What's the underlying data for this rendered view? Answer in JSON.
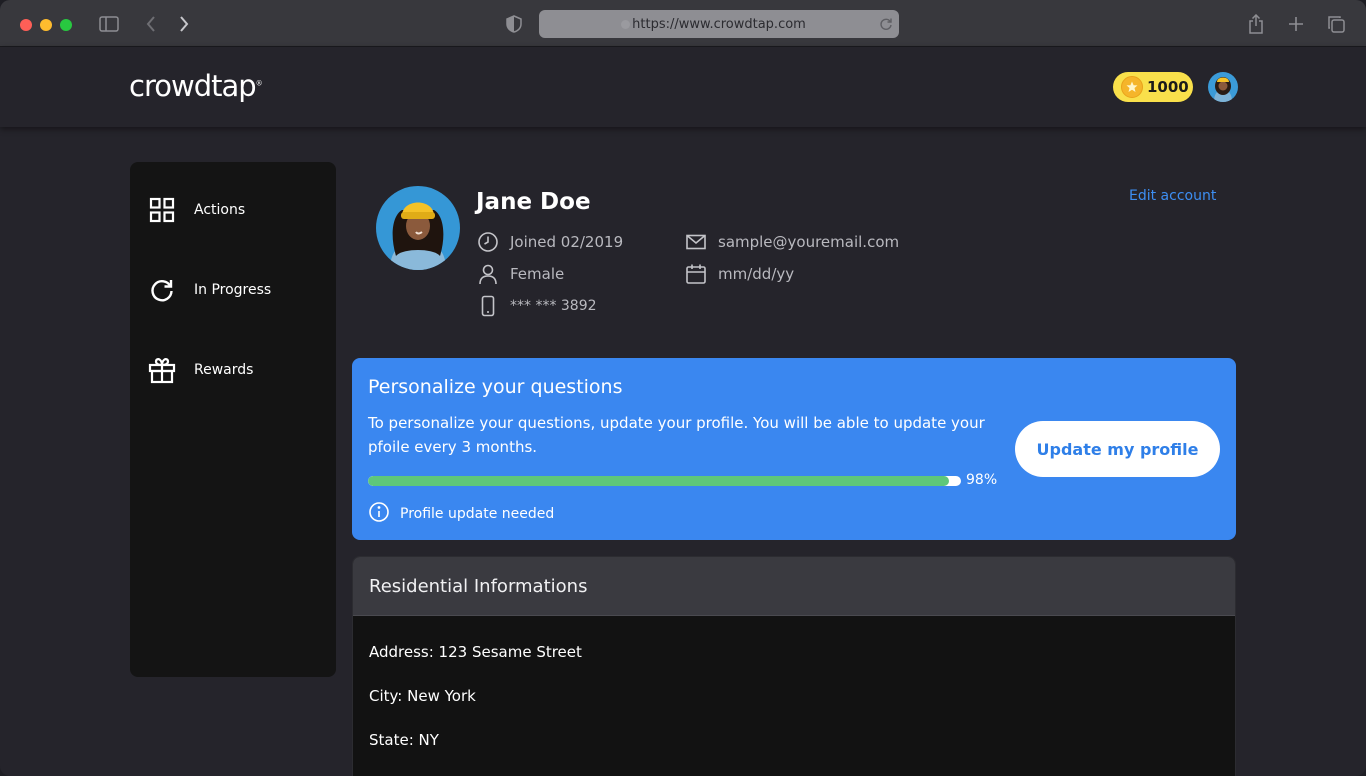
{
  "browser": {
    "url": "https://www.crowdtap.com"
  },
  "header": {
    "logo": "crowdtap",
    "logo_mark": "®",
    "coins": "1000"
  },
  "sidebar": {
    "items": [
      {
        "label": "Actions",
        "icon": "grid-icon"
      },
      {
        "label": "In Progress",
        "icon": "refresh-icon"
      },
      {
        "label": "Rewards",
        "icon": "gift-icon"
      }
    ]
  },
  "profile": {
    "name": "Jane Doe",
    "edit_label": "Edit account",
    "joined": "Joined 02/2019",
    "gender": "Female",
    "phone": "*** *** 3892",
    "email": "sample@youremail.com",
    "birthday": "mm/dd/yy"
  },
  "personalize": {
    "title": "Personalize your questions",
    "text": "To personalize your questions, update your profile. You will be able to update your pfoile every 3 months.",
    "progress": 0.98,
    "progress_label": "98%",
    "notice": "Profile update needed",
    "button_label": "Update my profile"
  },
  "residential": {
    "title": "Residential Informations",
    "address": "Address: 123 Sesame Street",
    "city": "City: New York",
    "state": "State: NY"
  },
  "colors": {
    "accent": "#3a87f0",
    "progress": "#5ec77a",
    "coin": "#f9e04b",
    "link": "#3d8ef2"
  }
}
